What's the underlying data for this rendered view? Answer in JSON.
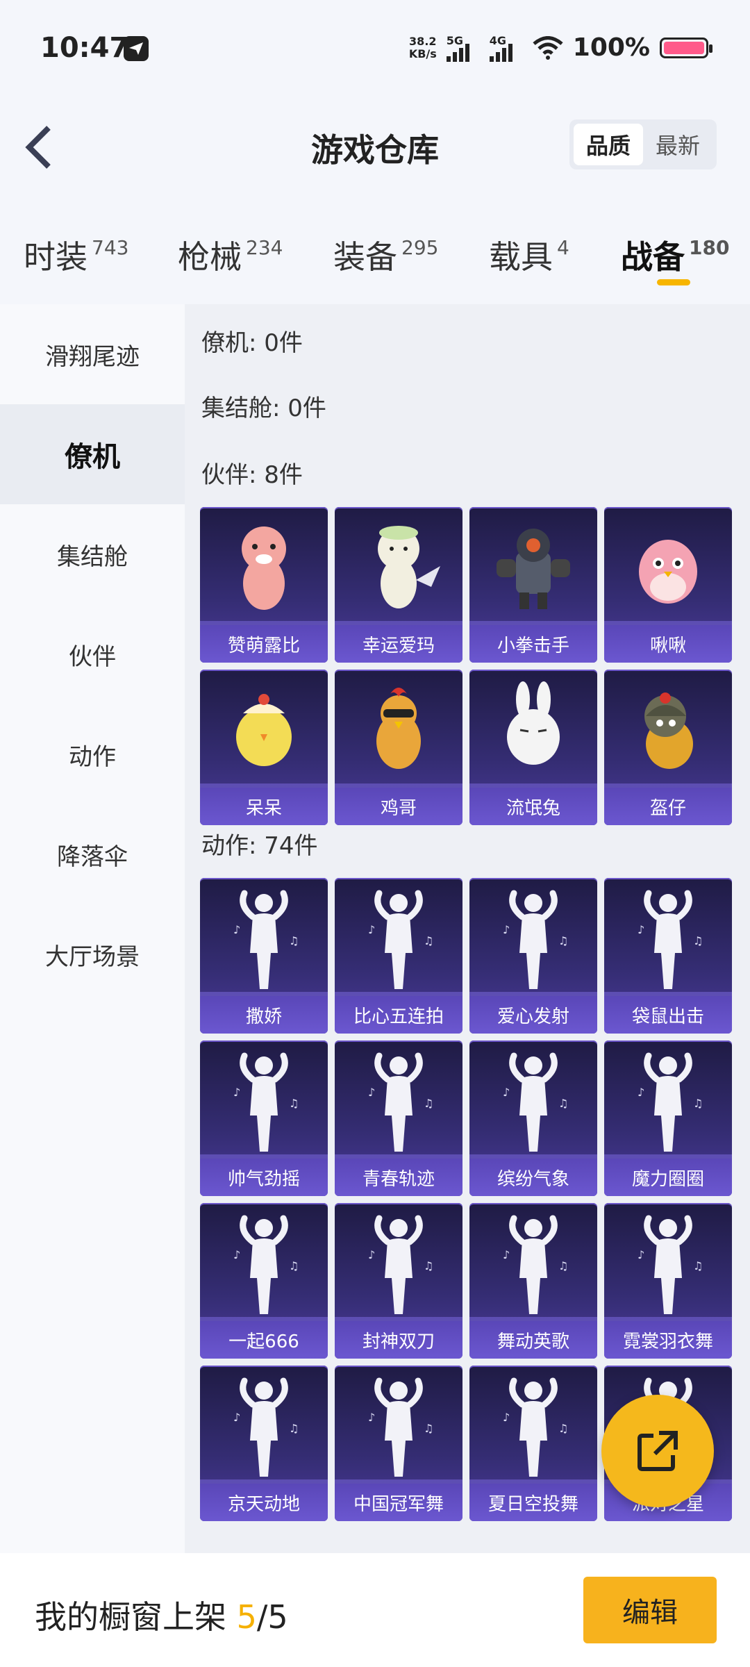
{
  "status": {
    "time": "10:47",
    "speed_top": "38.2",
    "speed_bottom": "KB/s",
    "net1": "5G",
    "net2": "4G",
    "battery": "100%",
    "battery_color": "#ff5a8a"
  },
  "header": {
    "title": "游戏仓库",
    "sort_options": [
      "品质",
      "最新"
    ]
  },
  "tabs": [
    {
      "label": "时装",
      "count": "743"
    },
    {
      "label": "枪械",
      "count": "234"
    },
    {
      "label": "装备",
      "count": "295"
    },
    {
      "label": "载具",
      "count": "4"
    },
    {
      "label": "战备",
      "count": "180"
    }
  ],
  "sidebar": [
    "滑翔尾迹",
    "僚机",
    "集结舱",
    "伙伴",
    "动作",
    "降落伞",
    "大厅场景"
  ],
  "sections": {
    "wingman": "僚机: 0件",
    "capsule": "集结舱: 0件",
    "partner": "伙伴: 8件",
    "action": "动作: 74件"
  },
  "partners": [
    "赞萌露比",
    "幸运爱玛",
    "小拳击手",
    "啾啾",
    "呆呆",
    "鸡哥",
    "流氓兔",
    "盔仔"
  ],
  "actions": [
    "撒娇",
    "比心五连拍",
    "爱心发射",
    "袋鼠出击",
    "帅气劲摇",
    "青春轨迹",
    "缤纷气象",
    "魔力圈圈",
    "一起666",
    "封神双刀",
    "舞动英歌",
    "霓裳羽衣舞",
    "京天动地",
    "中国冠军舞",
    "夏日空投舞",
    "派对之星"
  ],
  "bottom": {
    "label": "我的橱窗上架",
    "current": "5",
    "separator": "/",
    "total": "5",
    "edit": "编辑"
  },
  "colors": {
    "accent": "#f7b21d",
    "card_top": "#1f1b44",
    "card_caption": "#6b57d0"
  }
}
